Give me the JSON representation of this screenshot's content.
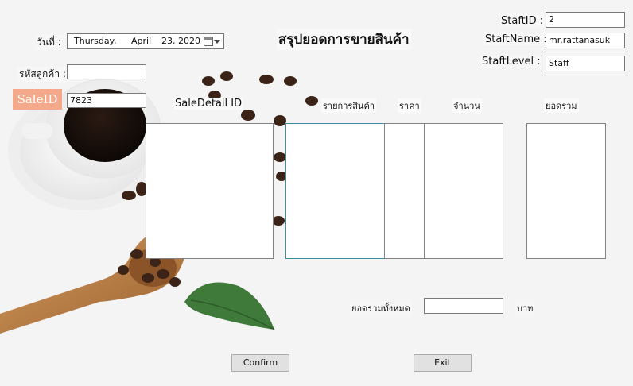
{
  "title": "สรุปยอดการขายสินค้า",
  "date": {
    "label": "วันที่ :",
    "weekday": "Thursday",
    "sep": ",",
    "month": "April",
    "day_year": "23, 2020"
  },
  "customer": {
    "label": "รหัสลูกค้า :",
    "value": ""
  },
  "sale": {
    "label": "SaleID",
    "value": "7823"
  },
  "staff": {
    "id_label": "StaftID :",
    "id_value": "2",
    "name_label": "StaftName :",
    "name_value": "mr.rattanasuk",
    "level_label": "StaftLevel :",
    "level_value": "Staff"
  },
  "columns": {
    "sale_detail_id": "SaleDetail ID",
    "product_list": "รายการสินค้า",
    "price": "ราคา",
    "quantity": "จำนวน",
    "total": "ยอดรวม"
  },
  "grand_total": {
    "label": "ยอดรวมทั้งหมด",
    "value": "",
    "unit": "บาท"
  },
  "buttons": {
    "confirm": "Confirm",
    "exit": "Exit"
  },
  "colors": {
    "saleid_bg": "#f4a98a",
    "coffee": "#3b2417",
    "leaf": "#3f7a3a",
    "spoon": "#b5793f"
  }
}
